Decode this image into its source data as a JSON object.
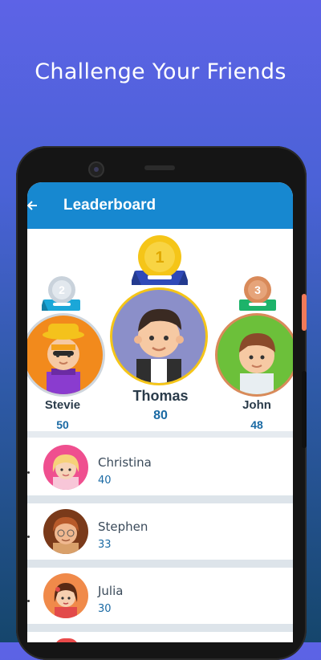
{
  "headline": "Challenge Your Friends",
  "appbar": {
    "title": "Leaderboard",
    "back_icon": "back-arrow-icon"
  },
  "podium": {
    "first": {
      "rank": "1",
      "name": "Thomas",
      "score": "80"
    },
    "second": {
      "rank": "2",
      "name": "Stevie",
      "score": "50"
    },
    "third": {
      "rank": "3",
      "name": "John",
      "score": "48"
    }
  },
  "list": [
    {
      "name": "Christina",
      "score": "40"
    },
    {
      "name": "Stephen",
      "score": "33"
    },
    {
      "name": "Julia",
      "score": "30"
    }
  ],
  "colors": {
    "appbar": "#1788d0",
    "gold": "#f5c518",
    "silver": "#c9d2db",
    "bronze": "#d98a5a",
    "accent_blue": "#1a6aa4"
  }
}
